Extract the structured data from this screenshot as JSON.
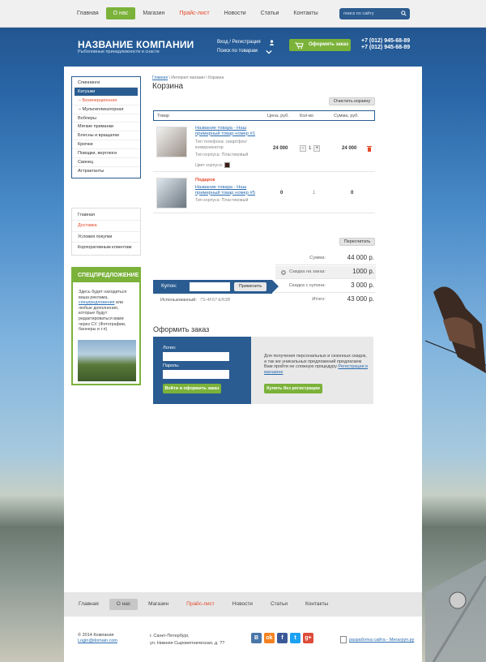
{
  "topnav": {
    "items": [
      {
        "label": "Главная"
      },
      {
        "label": "О нас"
      },
      {
        "label": "Магазин"
      },
      {
        "label": "Прайс-лист"
      },
      {
        "label": "Новости"
      },
      {
        "label": "Статьи"
      },
      {
        "label": "Контакты"
      }
    ]
  },
  "search": {
    "placeholder": "поиск по сайту"
  },
  "header": {
    "company": "НАЗВАНИЕ КОМПАНИИ",
    "tagline": "Рыболовные принадлежности и снасти",
    "login": "Вход / Регистрация",
    "search_goods": "Поиск по товарам",
    "order": "Оформить заказ",
    "phone1": "+7 (012) 945-68-89",
    "phone2": "+7 (012) 945-68-89"
  },
  "sidebar": {
    "categories": [
      "Спиннинги",
      "Катушки",
      "– Безинерционная",
      "– Мультипликаторная",
      "Воблеры",
      "Мягкие приманки",
      "Блесны и вращалки",
      "Крючки",
      "Поводки, вертлюги",
      "Свинец",
      "Аттрактанты"
    ],
    "info": [
      "Главная",
      "Доставка",
      "Условия покупки",
      "Корпоративным клиентам"
    ]
  },
  "promo": {
    "title": "СПЕЦПРЕДЛОЖЕНИЕ",
    "text_before": "Здесь будет находиться ваша реклама, ",
    "link": "спецпредложения",
    "text_after": " или любые дополнения, которые будут редактироваться вами через CУ. (Фотографии, баннеры и т.п)"
  },
  "crumbs": {
    "home": "Главная",
    "shop": "Интернет магазин",
    "current": "Корзина"
  },
  "cart": {
    "title": "Корзина",
    "clear": "Очистить корзину",
    "cols": {
      "product": "Товар",
      "price": "Цена, руб.",
      "qty": "Кол-во",
      "sum": "Сумма, руб."
    },
    "items": [
      {
        "name": "Название товара - Наш примерный товар номер #1",
        "meta1": "Тип телефона: смартфон/коммуникатор",
        "meta2": "Тип корпуса: Пластиковый",
        "meta3": "Цвет корпуса:",
        "price": "24 000",
        "qty": "1",
        "sum": "24 000"
      },
      {
        "gift": "Подарок",
        "name": "Название товара - Наш примерный товар номер #5",
        "meta1": "Тип корпуса: Пластиковый",
        "price": "0",
        "qty": "1",
        "sum": "0"
      }
    ],
    "recalc": "Пересчитать",
    "summary": [
      {
        "label": "Сумма:",
        "value": "44 000 р."
      },
      {
        "label": "Скидка на заказ:",
        "value": "1000 р."
      },
      {
        "label": "Скидка с купона:",
        "value": "3 000 р."
      },
      {
        "label": "Итого:",
        "value": "43 000 р."
      }
    ],
    "coupon": {
      "label": "Купон:",
      "apply": "Применить"
    },
    "used_label": "Использованный:",
    "used_code": "7S-4F67-ER3B"
  },
  "checkout": {
    "title": "Оформить заказ",
    "login_label": "Логин:",
    "password_label": "Пароль:",
    "login_button": "Войти и оформить заказ",
    "reg_text": "Для получения персональных и сезонных скидок, а так же уникальных предложений предлагаем Вам пройти не сложную процедуру ",
    "reg_link": "Регистрации в магазине",
    "buy_button": "Купить без регистрации"
  },
  "footnav": {
    "items": [
      "Главная",
      "О нас",
      "Магазин",
      "Прайс-лист",
      "Новости",
      "Статьи",
      "Контакты"
    ]
  },
  "footer": {
    "copy": "© 2014 Компания",
    "email": "Login@domain.com",
    "city": "г.  Санкт-Петербург,",
    "street": "ул. Нижняя Сыромятническая,  д. ??",
    "dev": "разработка сайта - Мегагруп.ру"
  },
  "social": [
    {
      "label": "В",
      "color": "#4a76a8"
    },
    {
      "label": "ok",
      "color": "#f58220"
    },
    {
      "label": "f",
      "color": "#3b5998"
    },
    {
      "label": "t",
      "color": "#1da1f2"
    },
    {
      "label": "g+",
      "color": "#dd4b39"
    }
  ],
  "colors": {
    "accent": "#7bb23a",
    "brand": "#2a5c91",
    "alert": "#e5492a"
  }
}
